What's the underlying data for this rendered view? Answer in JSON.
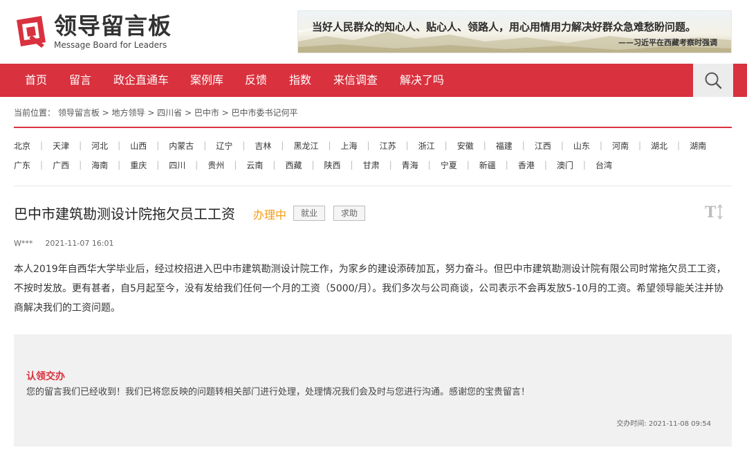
{
  "header": {
    "logo_cn": "领导留言板",
    "logo_en": "Message Board for Leaders",
    "banner_motto": "当好人民群众的知心人、贴心人、领路人，用心用情用力解决好群众急难愁盼问题。",
    "banner_source": "——习近平在西藏考察时强调"
  },
  "nav": {
    "items": [
      {
        "label": "首页"
      },
      {
        "label": "留言"
      },
      {
        "label": "政企直通车"
      },
      {
        "label": "案例库"
      },
      {
        "label": "反馈"
      },
      {
        "label": "指数"
      },
      {
        "label": "来信调查"
      },
      {
        "label": "解决了吗"
      }
    ]
  },
  "breadcrumb": {
    "text": "当前位置： 领导留言板 > 地方领导 > 四川省 > 巴中市 > 巴中市委书记何平"
  },
  "regions": {
    "row1": [
      "北京",
      "天津",
      "河北",
      "山西",
      "内蒙古",
      "辽宁",
      "吉林",
      "黑龙江",
      "上海",
      "江苏",
      "浙江",
      "安徽",
      "福建",
      "江西",
      "山东",
      "河南",
      "湖北",
      "湖南"
    ],
    "row2": [
      "广东",
      "广西",
      "海南",
      "重庆",
      "四川",
      "贵州",
      "云南",
      "西藏",
      "陕西",
      "甘肃",
      "青海",
      "宁夏",
      "新疆",
      "香港",
      "澳门",
      "台湾"
    ]
  },
  "post": {
    "title": "巴中市建筑勘测设计院拖欠员工工资",
    "status": "办理中",
    "tags": [
      "就业",
      "求助"
    ],
    "author": "W***",
    "time": "2021-11-07 16:01",
    "body": "本人2019年自西华大学毕业后，经过校招进入巴中市建筑勘测设计院工作，为家乡的建设添砖加瓦，努力奋斗。但巴中市建筑勘测设计院有限公司时常拖欠员工工资，不按时发放。更有甚者，自5月起至今，没有发给我们任何一个月的工资（5000/月）。我们多次与公司商谈，公司表示不会再发放5-10月的工资。希望领导能关注并协商解决我们的工资问题。"
  },
  "reply": {
    "title": "认领交办",
    "text": "您的留言我们已经收到！我们已将您反映的问题转相关部门进行处理，处理情况我们会及时与您进行沟通。感谢您的宝贵留言！",
    "time": "交办时间: 2021-11-08 09:54"
  },
  "colors": {
    "brand_red": "#d9313e",
    "status_orange": "#f39c12"
  },
  "icons": {
    "search": "search-icon",
    "font_size": "font-size-icon",
    "logo": "logo-mark-icon"
  }
}
